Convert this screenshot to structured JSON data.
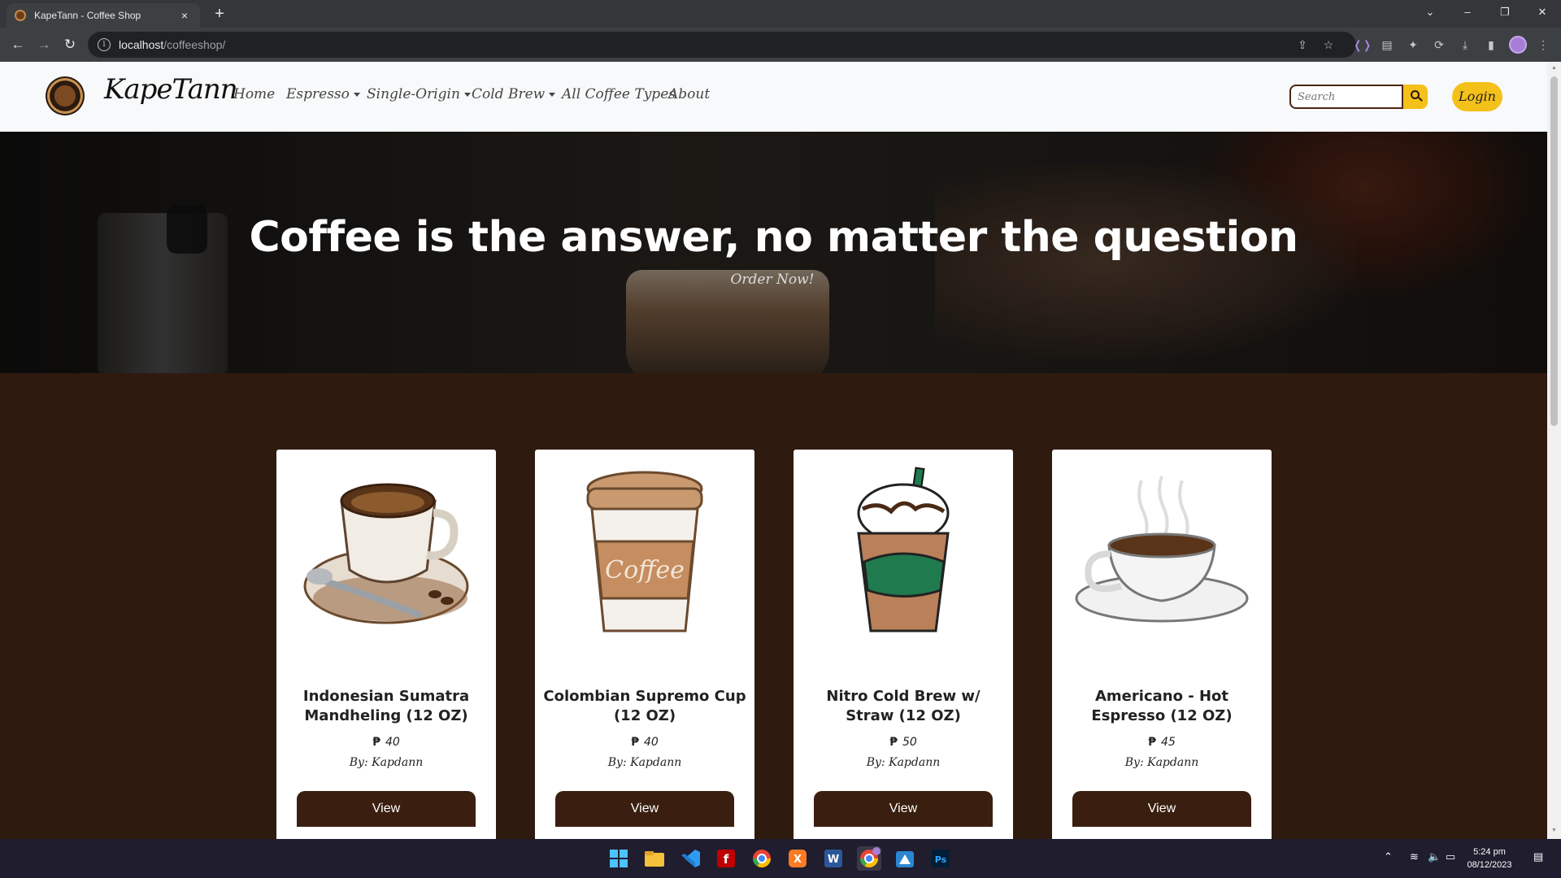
{
  "browser": {
    "tab_title": "KapeTann - Coffee Shop",
    "tab_close": "×",
    "new_tab": "+",
    "window_controls": {
      "list": "⌄",
      "minimize": "–",
      "restore": "❐",
      "close": "✕"
    },
    "url_host": "localhost",
    "url_path": "/coffeeshop/",
    "info_icon_glyph": "i",
    "toolbar_icons": [
      "share-icon",
      "star-icon",
      "dev-extension-icon",
      "reading-list-icon",
      "extensions-puzzle-icon",
      "sync-icon",
      "download-icon",
      "sidebar-icon",
      "profile-avatar"
    ]
  },
  "site": {
    "brand": "KapeTann",
    "nav": [
      {
        "label": "Home",
        "dropdown": false
      },
      {
        "label": "Espresso",
        "dropdown": true
      },
      {
        "label": "Single-Origin",
        "dropdown": true
      },
      {
        "label": "Cold Brew",
        "dropdown": true
      },
      {
        "label": "All Coffee Types",
        "dropdown": false
      },
      {
        "label": "About",
        "dropdown": false
      }
    ],
    "search_placeholder": "Search",
    "login_label": "Login",
    "accent_color": "#f4c01a",
    "dark_brown": "#2f1a10"
  },
  "hero": {
    "title": "Coffee is the answer, no matter the question",
    "cta": "Order Now!"
  },
  "products": [
    {
      "name": "Indonesian Sumatra Mandheling (12 OZ)",
      "currency": "₱",
      "price": "40",
      "by": "By: Kapdann",
      "view_label": "View",
      "image": "coffee-cup-saucer-illustration"
    },
    {
      "name": "Colombian Supremo Cup (12 OZ)",
      "currency": "₱",
      "price": "40",
      "by": "By: Kapdann",
      "view_label": "View",
      "image": "takeaway-cup-illustration"
    },
    {
      "name": "Nitro Cold Brew w/ Straw (12 OZ)",
      "currency": "₱",
      "price": "50",
      "by": "By: Kapdann",
      "view_label": "View",
      "image": "frappe-cup-illustration"
    },
    {
      "name": "Americano - Hot Espresso (12 OZ)",
      "currency": "₱",
      "price": "45",
      "by": "By: Kapdann",
      "view_label": "View",
      "image": "hot-coffee-cup-illustration"
    }
  ],
  "taskbar": {
    "apps": [
      "windows-start-icon",
      "file-explorer-icon",
      "vscode-icon",
      "filezilla-icon",
      "chrome-icon",
      "xampp-icon",
      "word-icon",
      "chrome-dev-icon",
      "store-icon",
      "photoshop-icon"
    ],
    "time": "5:24 pm",
    "date": "08/12/2023"
  }
}
